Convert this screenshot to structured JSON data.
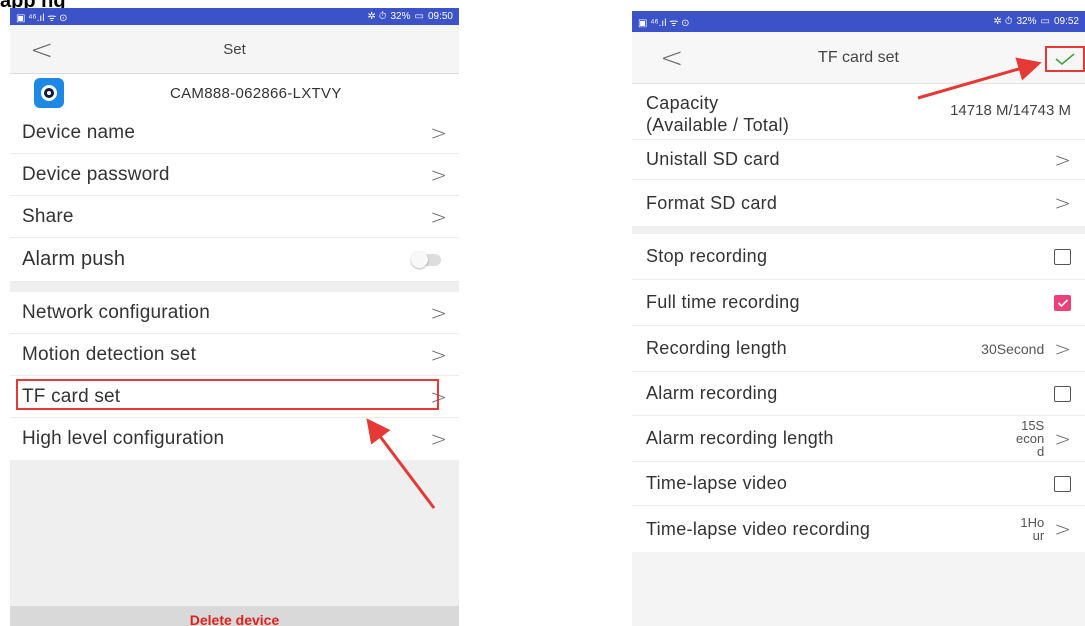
{
  "top_fragment": "app ng",
  "left": {
    "statusbar": {
      "icons_left": "▣ ⁴⁶.ıl ᯤ ⊙",
      "icons_right": "✲ ⏱",
      "battery": "32%",
      "time": "09:50"
    },
    "nav": {
      "back": "<",
      "title": "Set"
    },
    "device_id": "CAM888-062866-LXTVY",
    "rows_group1": [
      {
        "label": "Device name",
        "chev": ">"
      },
      {
        "label": "Device password",
        "chev": ">"
      },
      {
        "label": "Share",
        "chev": ">"
      },
      {
        "label": "Alarm push"
      }
    ],
    "rows_group2": [
      {
        "label": "Network configuration",
        "chev": ">"
      },
      {
        "label": "Motion detection set",
        "chev": ">"
      },
      {
        "label": "TF card set",
        "chev": ">"
      },
      {
        "label": "High level configuration",
        "chev": ">"
      }
    ],
    "delete_label": "Delete device"
  },
  "right": {
    "statusbar": {
      "icons_left": "▣ ⁴⁶.ıl ᯤ ⊙",
      "icons_right": "✲ ⏱",
      "battery": "32%",
      "time": "09:52"
    },
    "nav": {
      "back": "<",
      "title": "TF card set"
    },
    "capacity": {
      "label": "Capacity\n(Available / Total)",
      "label_line1": "Capacity",
      "label_line2": "(Available / Total)",
      "value": "14718 M/14743 M"
    },
    "uninstall": {
      "label": "Unistall SD card",
      "chev": ">"
    },
    "format": {
      "label": "Format SD card",
      "chev": ">"
    },
    "stop_recording": {
      "label": "Stop recording",
      "checked": false
    },
    "full_time": {
      "label": "Full time recording",
      "checked": true
    },
    "recording_length": {
      "label": "Recording length",
      "value": "30Second",
      "chev": ">"
    },
    "alarm_recording": {
      "label": "Alarm recording",
      "checked": false
    },
    "alarm_length": {
      "label": "Alarm recording length",
      "value": "15Second",
      "chev": ">"
    },
    "timelapse": {
      "label": "Time-lapse video",
      "checked": false
    },
    "timelapse_recording": {
      "label": "Time-lapse video recording",
      "value": "1Hour",
      "chev": ">"
    }
  },
  "colors": {
    "statusbar": "#3c52c9",
    "highlight": "#e53935",
    "checkbox_checked": "#ec407a",
    "delete_text": "#e0211d",
    "confirm_check": "#43a047"
  }
}
